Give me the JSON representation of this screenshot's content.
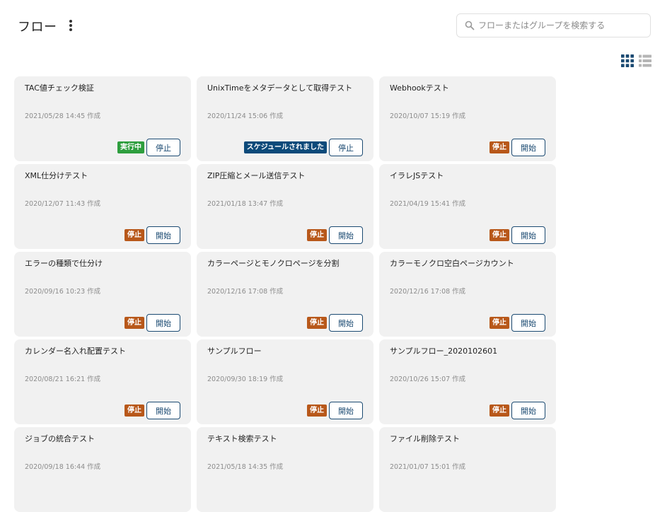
{
  "header": {
    "title": "フロー",
    "search_placeholder": "フローまたはグループを検索する",
    "search_value": ""
  },
  "icons": {
    "menu": "more-vert-icon",
    "search": "search-icon",
    "grid_view": "grid-view-icon",
    "list_view": "list-view-icon"
  },
  "colors": {
    "running_badge": "#2e9e3e",
    "stopped_badge": "#b8581a",
    "scheduled_badge": "#0c4a7a",
    "active_view_icon": "#1b4a72",
    "inactive_view_icon": "#b5b5b5",
    "card_background": "#f1f1f1"
  },
  "flows": [
    {
      "title": "TAC値チェック検証",
      "created": "2021/05/28 14:45 作成",
      "status": "実行中",
      "status_type": "running",
      "action": "停止"
    },
    {
      "title": "UnixTimeをメタデータとして取得テスト",
      "created": "2020/11/24 15:06 作成",
      "status": "スケジュールされました",
      "status_type": "scheduled",
      "action": "停止"
    },
    {
      "title": "Webhookテスト",
      "created": "2020/10/07 15:19 作成",
      "status": "停止",
      "status_type": "stopped",
      "action": "開始"
    },
    {
      "title": "XML仕分けテスト",
      "created": "2020/12/07 11:43 作成",
      "status": "停止",
      "status_type": "stopped",
      "action": "開始"
    },
    {
      "title": "ZIP圧縮とメール送信テスト",
      "created": "2021/01/18 13:47 作成",
      "status": "停止",
      "status_type": "stopped",
      "action": "開始"
    },
    {
      "title": "イラレJSテスト",
      "created": "2021/04/19 15:41 作成",
      "status": "停止",
      "status_type": "stopped",
      "action": "開始"
    },
    {
      "title": "エラーの種類で仕分け",
      "created": "2020/09/16 10:23 作成",
      "status": "停止",
      "status_type": "stopped",
      "action": "開始"
    },
    {
      "title": "カラーページとモノクロページを分割",
      "created": "2020/12/16 17:08 作成",
      "status": "停止",
      "status_type": "stopped",
      "action": "開始"
    },
    {
      "title": "カラーモノクロ空白ページカウント",
      "created": "2020/12/16 17:08 作成",
      "status": "停止",
      "status_type": "stopped",
      "action": "開始"
    },
    {
      "title": "カレンダー名入れ配置テスト",
      "created": "2020/08/21 16:21 作成",
      "status": "停止",
      "status_type": "stopped",
      "action": "開始"
    },
    {
      "title": "サンプルフロー",
      "created": "2020/09/30 18:19 作成",
      "status": "停止",
      "status_type": "stopped",
      "action": "開始"
    },
    {
      "title": "サンプルフロー_2020102601",
      "created": "2020/10/26 15:07 作成",
      "status": "停止",
      "status_type": "stopped",
      "action": "開始"
    },
    {
      "title": "ジョブの統合テスト",
      "created": "2020/09/18 16:44 作成",
      "status": "",
      "status_type": "",
      "action": ""
    },
    {
      "title": "テキスト検索テスト",
      "created": "2021/05/18 14:35 作成",
      "status": "",
      "status_type": "",
      "action": ""
    },
    {
      "title": "ファイル削除テスト",
      "created": "2021/01/07 15:01 作成",
      "status": "",
      "status_type": "",
      "action": ""
    }
  ]
}
